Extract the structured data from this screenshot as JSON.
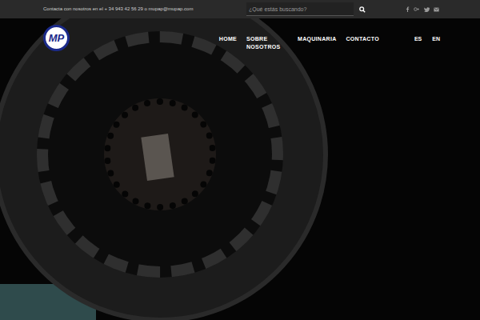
{
  "topbar": {
    "contact": "Contacta con nosotros en el + 34 943 42 56 29 o mupap@mupap.com"
  },
  "search": {
    "placeholder": "¿Qué estás buscando?"
  },
  "logo": {
    "text": "MP"
  },
  "nav": [
    {
      "label": "HOME"
    },
    {
      "label": "SOBRE NOSOTROS"
    },
    {
      "label": "MAQUINARIA"
    },
    {
      "label": "CONTACTO"
    }
  ],
  "languages": [
    {
      "label": "ES"
    },
    {
      "label": "EN"
    }
  ]
}
